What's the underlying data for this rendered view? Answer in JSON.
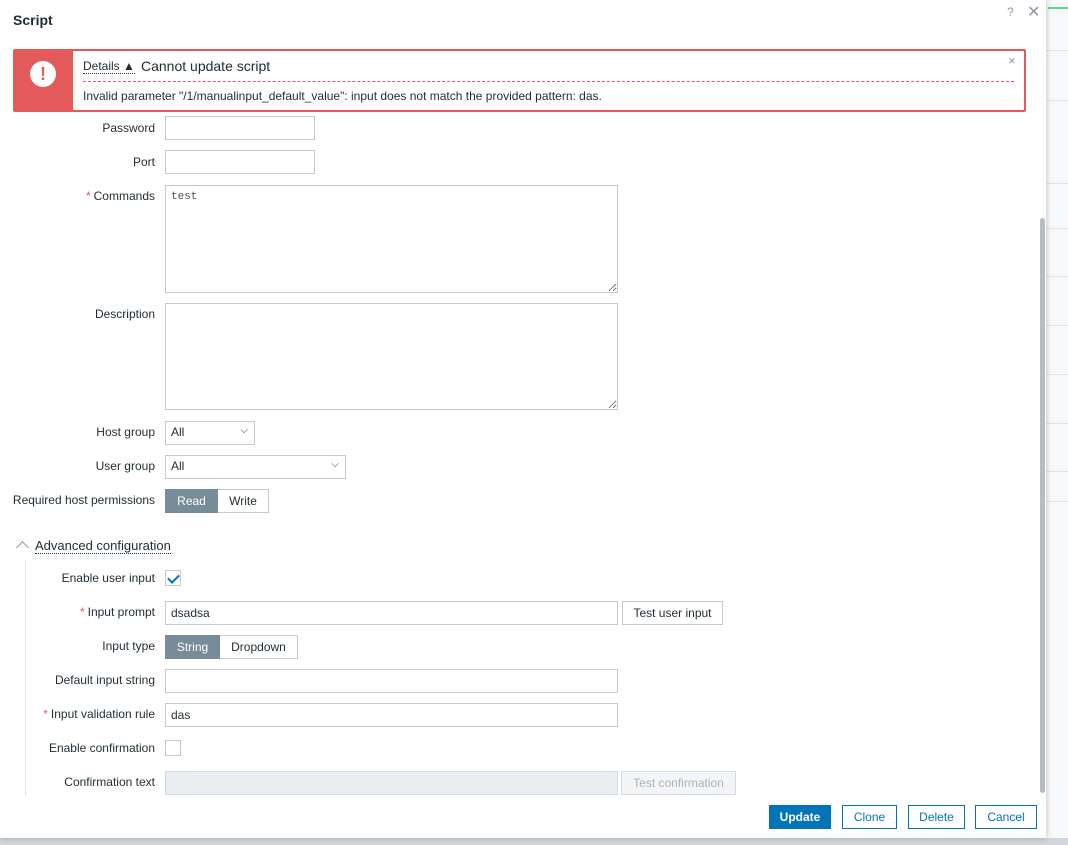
{
  "dialog": {
    "title": "Script",
    "help_glyph": "?",
    "close_glyph": "✕"
  },
  "error": {
    "details_label": "Details ▲",
    "title": "Cannot update script",
    "message": "Invalid parameter \"/1/manualinput_default_value\": input does not match the provided pattern: das.",
    "close_glyph": "×",
    "icon_glyph": "!"
  },
  "form": {
    "password_label": "Password",
    "password_value": "",
    "port_label": "Port",
    "port_value": "",
    "commands_label": "Commands",
    "commands_value": "test",
    "description_label": "Description",
    "description_value": "",
    "host_group_label": "Host group",
    "host_group_value": "All",
    "user_group_label": "User group",
    "user_group_value": "All",
    "host_permissions_label": "Required host permissions",
    "host_permissions_options": [
      "Read",
      "Write"
    ],
    "host_permissions_selected": "Read"
  },
  "advanced": {
    "toggle_label": "Advanced configuration",
    "enable_user_input_label": "Enable user input",
    "enable_user_input_checked": true,
    "input_prompt_label": "Input prompt",
    "input_prompt_value": "dsadsa",
    "test_user_input_label": "Test user input",
    "input_type_label": "Input type",
    "input_type_options": [
      "String",
      "Dropdown"
    ],
    "input_type_selected": "String",
    "default_input_string_label": "Default input string",
    "default_input_string_value": "",
    "input_validation_rule_label": "Input validation rule",
    "input_validation_rule_value": "das",
    "enable_confirmation_label": "Enable confirmation",
    "enable_confirmation_checked": false,
    "confirmation_text_label": "Confirmation text",
    "confirmation_text_value": "",
    "test_confirmation_label": "Test confirmation"
  },
  "footer": {
    "update_label": "Update",
    "clone_label": "Clone",
    "delete_label": "Delete",
    "cancel_label": "Cancel"
  },
  "colors": {
    "error": "#e45959",
    "primary": "#0275b8",
    "segment_active": "#768d99"
  }
}
